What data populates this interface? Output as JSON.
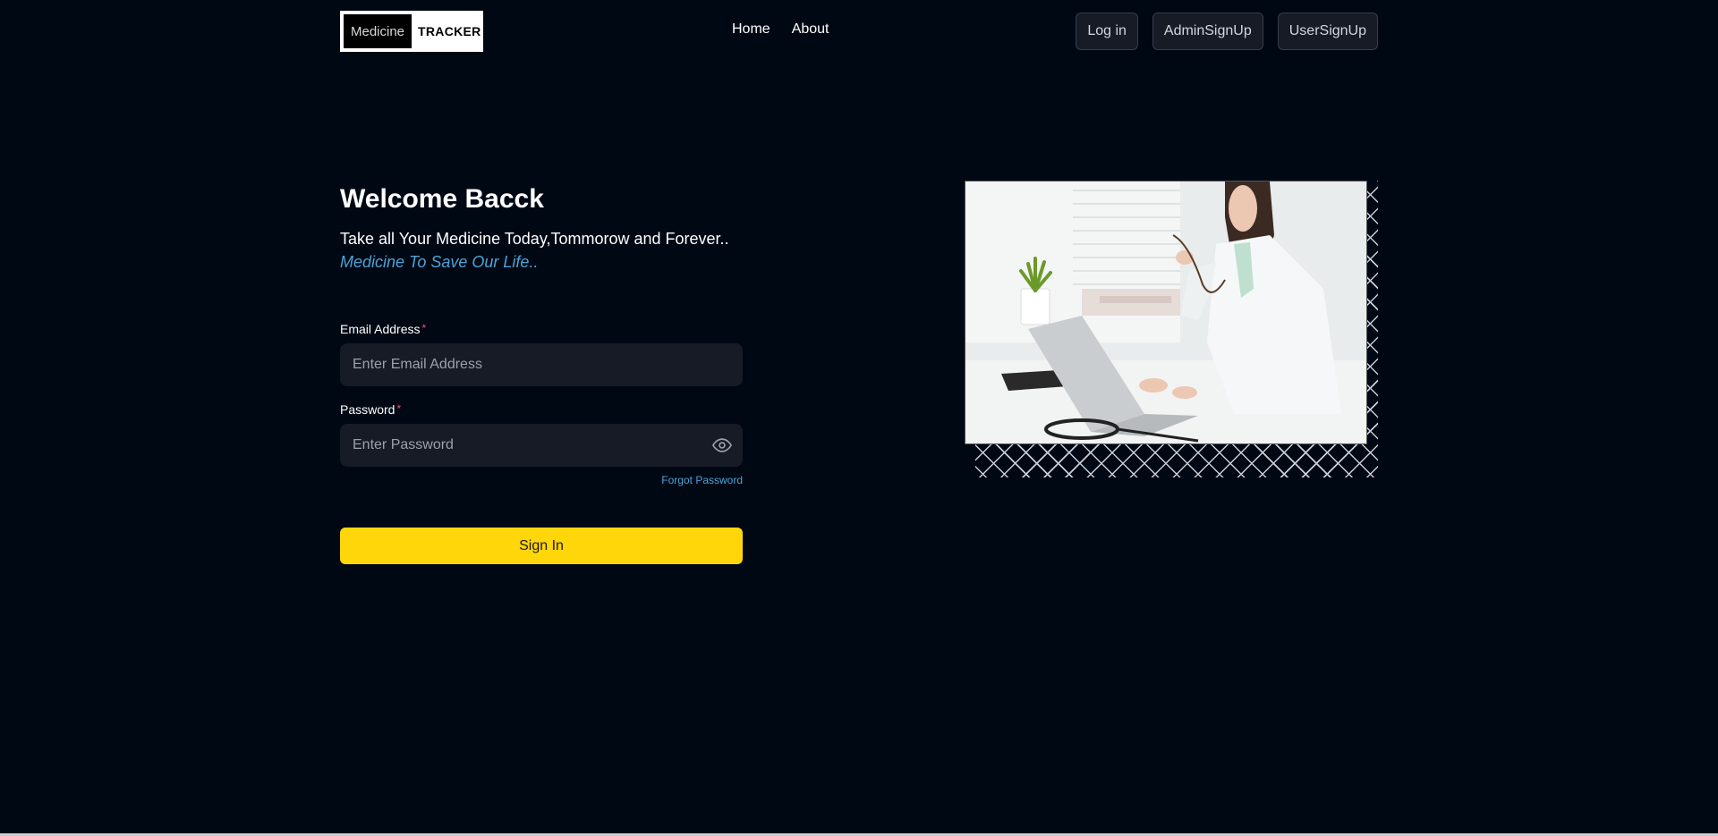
{
  "navbar": {
    "logo": {
      "part1": "Medicine",
      "part2": "TRACKER"
    },
    "links": {
      "home": "Home",
      "about": "About"
    },
    "buttons": {
      "login": "Log in",
      "admin_signup": "AdminSignUp",
      "user_signup": "UserSignUp"
    }
  },
  "login": {
    "title": "Welcome Bacck",
    "tagline": "Take all Your Medicine Today,Tommorow and Forever..",
    "subtagline": "Medicine To Save Our Life..",
    "email": {
      "label": "Email Address",
      "required_mark": "*",
      "placeholder": "Enter Email Address",
      "value": ""
    },
    "password": {
      "label": "Password",
      "required_mark": "*",
      "placeholder": "Enter Password",
      "value": ""
    },
    "forgot_password": "Forgot Password",
    "signin_label": "Sign In"
  },
  "colors": {
    "background": "#000814",
    "accent_yellow": "#ffd60a",
    "link_blue": "#4da3d6",
    "input_bg": "#161b26"
  },
  "icons": {
    "password_toggle": "eye-icon"
  },
  "hero_image": {
    "subject": "doctor-at-laptop-photo"
  }
}
